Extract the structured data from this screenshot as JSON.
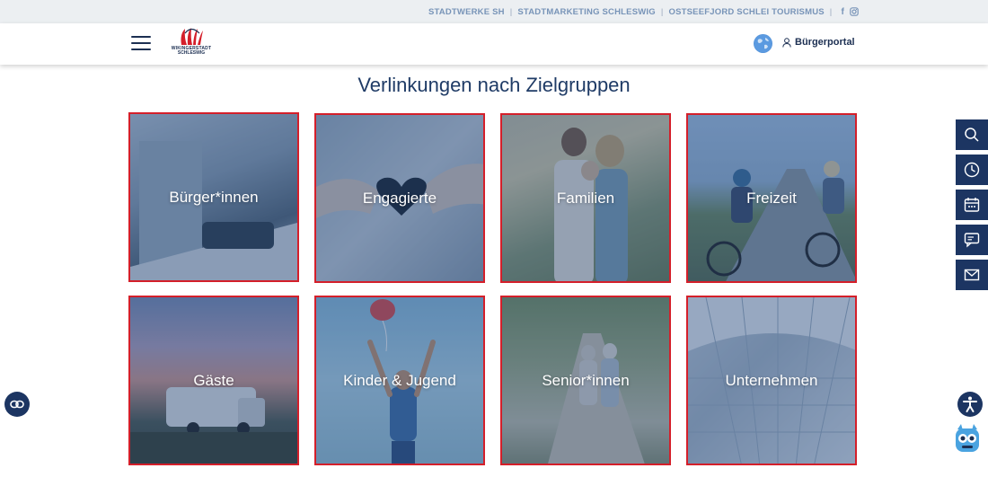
{
  "topbar": {
    "links": [
      "STADTWERKE SH",
      "STADTMARKETING SCHLESWIG",
      "OSTSEEFJORD SCHLEI TOURISMUS"
    ],
    "separator": "|",
    "facebook": "f"
  },
  "header": {
    "logo_line1": "WIKINGERSTADT",
    "logo_line2": "SCHLESWIG",
    "portal_label": "Bürgerportal"
  },
  "main": {
    "title": "Verlinkungen nach Zielgruppen",
    "tiles": [
      {
        "label": "Bürger*innen"
      },
      {
        "label": "Engagierte"
      },
      {
        "label": "Familien"
      },
      {
        "label": "Freizeit"
      },
      {
        "label": "Gäste"
      },
      {
        "label": "Kinder & Jugend"
      },
      {
        "label": "Senior*innen"
      },
      {
        "label": "Unternehmen"
      }
    ]
  },
  "icons": {
    "sidebar": [
      "search-icon",
      "clock-icon",
      "calendar-icon",
      "chat-icon",
      "mail-icon"
    ],
    "left": "link-icon",
    "accessibility": "accessibility-icon",
    "chatbot": "chatbot-icon"
  },
  "colors": {
    "navy": "#1c3562",
    "tile_border": "#d41f2a",
    "topbar_text": "#7894b8",
    "title": "#1f3b66"
  }
}
